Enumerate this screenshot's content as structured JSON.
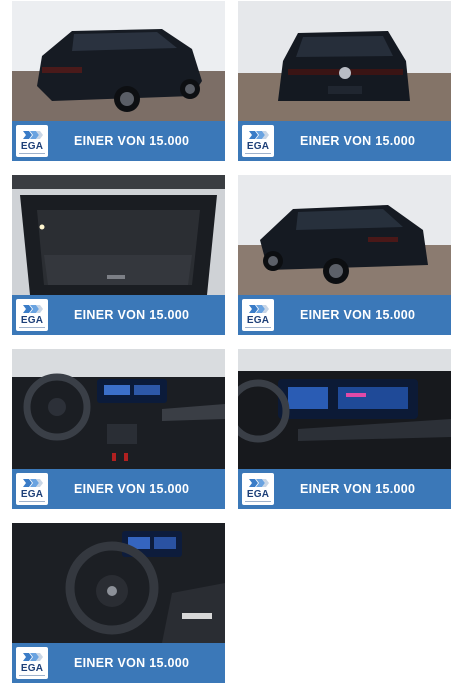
{
  "gallery": {
    "banner_text": "EINER VON 15.000",
    "logo_text": "EGA",
    "colors": {
      "banner": "#3b78b8",
      "logo_text": "#1d3f78",
      "car_body": "#151a22"
    },
    "images": [
      {
        "subject": "rear three-quarter view of black hatchback in showroom"
      },
      {
        "subject": "rear view of black hatchback"
      },
      {
        "subject": "open trunk / cargo area"
      },
      {
        "subject": "side rear view of black hatchback"
      },
      {
        "subject": "dashboard and steering wheel interior"
      },
      {
        "subject": "dashboard digital displays close-up"
      },
      {
        "subject": "steering wheel and center console"
      }
    ]
  }
}
